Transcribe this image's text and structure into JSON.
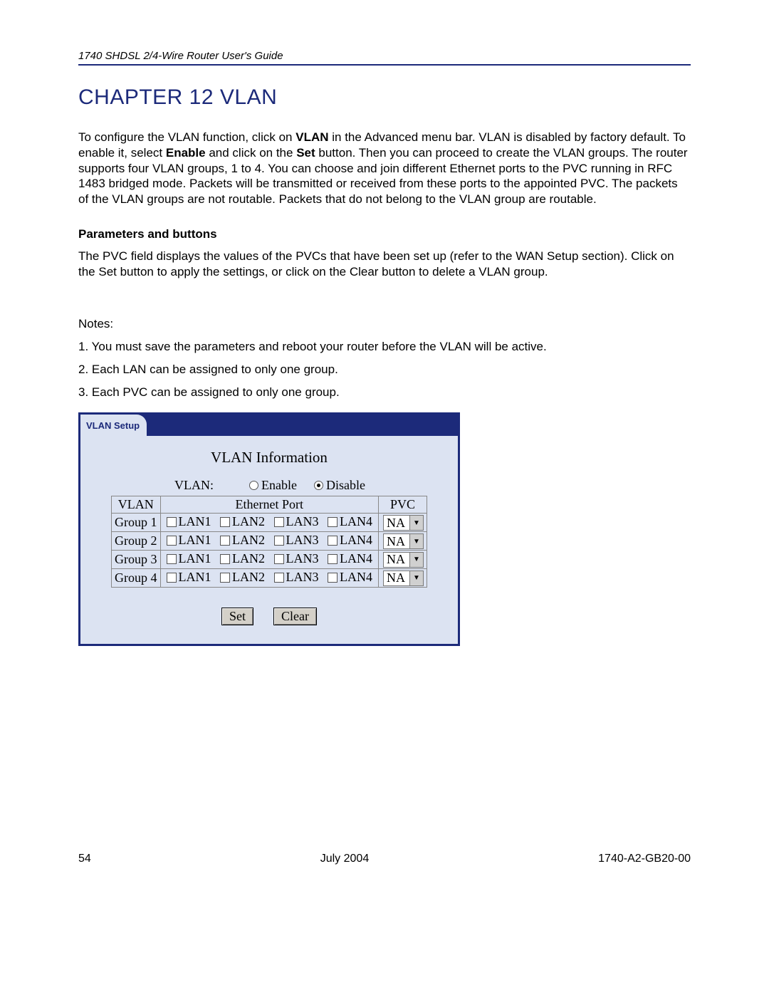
{
  "header": {
    "guide": "1740 SHDSL 2/4-Wire Router User's Guide"
  },
  "chapter": {
    "title": "CHAPTER 12   VLAN"
  },
  "intro": {
    "p1a": "To configure the VLAN function, click on ",
    "p1b": "VLAN",
    "p1c": " in the Advanced menu bar. VLAN is disabled by factory default. To enable it, select ",
    "p1d": "Enable",
    "p1e": " and click on the ",
    "p1f": "Set",
    "p1g": " button. Then you can proceed to create the VLAN groups. The router supports four VLAN groups, 1 to 4. You can choose and join different Ethernet ports to the PVC running in RFC 1483 bridged mode. Packets will be transmitted or received from these ports to the appointed PVC. The packets of the VLAN groups are not routable. Packets that do not belong to the VLAN group are routable."
  },
  "params": {
    "heading": "Parameters and buttons",
    "text": "The PVC field displays the values of the PVCs that have been set up (refer to the WAN Setup section). Click on the Set button to apply the settings, or click on the Clear button to delete a VLAN group."
  },
  "notes": {
    "label": "Notes:",
    "n1": "1. You must save the parameters and reboot your router before the VLAN will be active.",
    "n2": "2. Each LAN can be assigned to only one group.",
    "n3": "3. Each PVC can be assigned to only one group."
  },
  "ui": {
    "tab": "VLAN Setup",
    "title": "VLAN Information",
    "radio_label": "VLAN:",
    "enable_label": "Enable",
    "disable_label": "Disable",
    "selected": "Disable",
    "col_vlan": "VLAN",
    "col_eth": "Ethernet Port",
    "col_pvc": "PVC",
    "groups": [
      {
        "name": "Group 1",
        "lans": [
          "LAN1",
          "LAN2",
          "LAN3",
          "LAN4"
        ],
        "pvc": "NA"
      },
      {
        "name": "Group 2",
        "lans": [
          "LAN1",
          "LAN2",
          "LAN3",
          "LAN4"
        ],
        "pvc": "NA"
      },
      {
        "name": "Group 3",
        "lans": [
          "LAN1",
          "LAN2",
          "LAN3",
          "LAN4"
        ],
        "pvc": "NA"
      },
      {
        "name": "Group 4",
        "lans": [
          "LAN1",
          "LAN2",
          "LAN3",
          "LAN4"
        ],
        "pvc": "NA"
      }
    ],
    "set_btn": "Set",
    "clear_btn": "Clear"
  },
  "footer": {
    "page": "54",
    "date": "July 2004",
    "doc": "1740-A2-GB20-00"
  }
}
